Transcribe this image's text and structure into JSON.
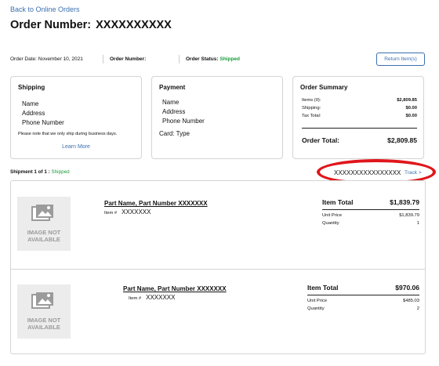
{
  "nav": {
    "back_label": "Back to Online Orders"
  },
  "header": {
    "title_label": "Order Number:",
    "title_value": "XXXXXXXXXX"
  },
  "meta": {
    "date_label": "Order Date:",
    "date_value": "November 10, 2021",
    "number_label": "Order Number:",
    "number_value": "",
    "status_label": "Order Status:",
    "status_value": "Shipped"
  },
  "return_button": "Return Item(s)",
  "shipping": {
    "title": "Shipping",
    "name": "Name",
    "address": "Address",
    "phone": "Phone Number",
    "note": "Please note that we only ship during business days.",
    "learn_more": "Learn More"
  },
  "payment": {
    "title": "Payment",
    "name": "Name",
    "address": "Address",
    "phone": "Phone Number",
    "card_label": "Card:",
    "card_value": "Type"
  },
  "summary": {
    "title": "Order Summary",
    "rows": [
      {
        "label": "Items (0):",
        "value": "$2,809.85"
      },
      {
        "label": "Shipping:",
        "value": "$0.00"
      },
      {
        "label": "Tax Total:",
        "value": "$0.00"
      }
    ],
    "total_label": "Order Total:",
    "total_value": "$2,809.85"
  },
  "shipment": {
    "header_label": "Shipment 1 of 1 :",
    "header_status": "Shipped",
    "tracking_number": "XXXXXXXXXXXXXXXX",
    "track_label": "Track >",
    "image_placeholder": [
      "IMAGE NOT",
      "AVAILABLE"
    ],
    "items": [
      {
        "name": "Part Name, Part Number XXXXXXX",
        "item_label": "Item #",
        "item_value": "XXXXXXX",
        "total_label": "Item Total",
        "total_value": "$1,839.79",
        "unit_label": "Unit Price",
        "unit_value": "$1,839.79",
        "qty_label": "Quantity",
        "qty_value": "1"
      },
      {
        "name": "Part Name, Part Number XXXXXXX",
        "item_label": "Item #",
        "item_value": "XXXXXXX",
        "total_label": "Item Total",
        "total_value": "$970.06",
        "unit_label": "Unit Price",
        "unit_value": "$485.03",
        "qty_label": "Quantity",
        "qty_value": "2"
      }
    ]
  },
  "colors": {
    "link": "#3a6fb0",
    "shipped": "#1a9b3a",
    "highlight": "#e0161b"
  }
}
